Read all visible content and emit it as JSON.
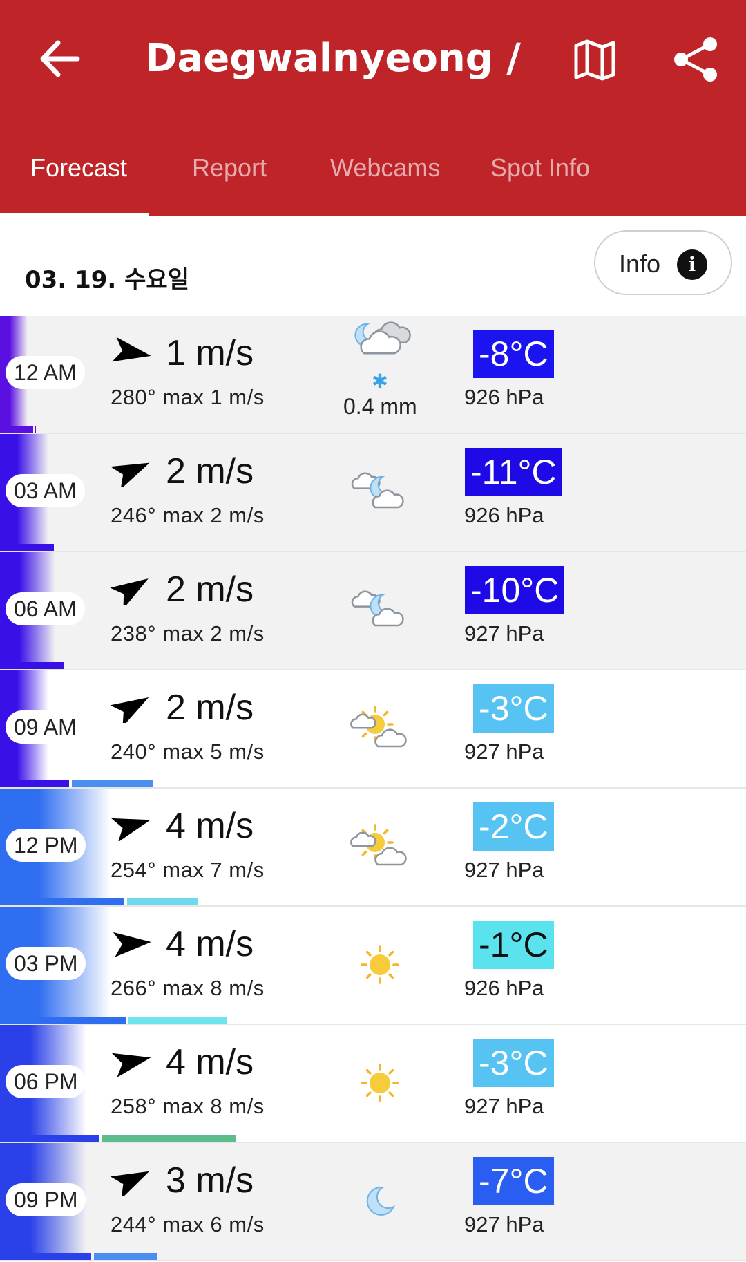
{
  "header": {
    "title": "Daegwalnyeong / P...",
    "back_icon": "arrow-left-icon",
    "map_icon": "map-icon",
    "share_icon": "share-icon",
    "background": "#bf2429"
  },
  "tabs": [
    {
      "label": "Forecast",
      "active": true
    },
    {
      "label": "Report",
      "active": false
    },
    {
      "label": "Webcams",
      "active": false
    },
    {
      "label": "Spot Info",
      "active": false
    }
  ],
  "date": "03. 19. 수요일",
  "info_button": {
    "label": "Info",
    "icon": "info-icon"
  },
  "forecast": [
    {
      "time": "12 AM",
      "speed": "1 m/s",
      "dir": "280°",
      "max": "max 1 m/s",
      "direction_deg": 280,
      "weather": "night-cloudy-snow",
      "precip": "0.4 mm",
      "temp": "-8°C",
      "temp_bg": "#1c14f0",
      "temp_fg": "#ffffff",
      "pressure": "926 hPa",
      "row_bg": "#f2f2f2",
      "grad_color": "#5a10e0"
    },
    {
      "time": "03 AM",
      "speed": "2 m/s",
      "dir": "246°",
      "max": "max 2 m/s",
      "direction_deg": 246,
      "weather": "night-partly-cloudy",
      "precip": "",
      "temp": "-11°C",
      "temp_bg": "#1e0ae6",
      "temp_fg": "#ffffff",
      "pressure": "926 hPa",
      "row_bg": "#f2f2f2",
      "grad_color": "#3a10e8"
    },
    {
      "time": "06 AM",
      "speed": "2 m/s",
      "dir": "238°",
      "max": "max 2 m/s",
      "direction_deg": 238,
      "weather": "night-partly-cloudy",
      "precip": "",
      "temp": "-10°C",
      "temp_bg": "#1e0ae6",
      "temp_fg": "#ffffff",
      "pressure": "927 hPa",
      "row_bg": "#f2f2f2",
      "grad_color": "#3a10e8"
    },
    {
      "time": "09 AM",
      "speed": "2 m/s",
      "dir": "240°",
      "max": "max 5 m/s",
      "direction_deg": 240,
      "weather": "sun-cloud",
      "precip": "",
      "temp": "-3°C",
      "temp_bg": "#56c3f2",
      "temp_fg": "#ffffff",
      "pressure": "927 hPa",
      "row_bg": "#ffffff",
      "grad_color": "#3a10e8"
    },
    {
      "time": "12 PM",
      "speed": "4 m/s",
      "dir": "254°",
      "max": "max 7 m/s",
      "direction_deg": 254,
      "weather": "sun-cloud",
      "precip": "",
      "temp": "-2°C",
      "temp_bg": "#56c3f2",
      "temp_fg": "#ffffff",
      "pressure": "927 hPa",
      "row_bg": "#ffffff",
      "grad_color": "#2f6ef0"
    },
    {
      "time": "03 PM",
      "speed": "4 m/s",
      "dir": "266°",
      "max": "max 8 m/s",
      "direction_deg": 266,
      "weather": "sun",
      "precip": "",
      "temp": "-1°C",
      "temp_bg": "#5ae3ee",
      "temp_fg": "#111111",
      "pressure": "926 hPa",
      "row_bg": "#ffffff",
      "grad_color": "#2f6ef0"
    },
    {
      "time": "06 PM",
      "speed": "4 m/s",
      "dir": "258°",
      "max": "max 8 m/s",
      "direction_deg": 258,
      "weather": "sun",
      "precip": "",
      "temp": "-3°C",
      "temp_bg": "#56c3f2",
      "temp_fg": "#ffffff",
      "pressure": "927 hPa",
      "row_bg": "#ffffff",
      "grad_color": "#2a40e8"
    },
    {
      "time": "09 PM",
      "speed": "3 m/s",
      "dir": "244°",
      "max": "max 6 m/s",
      "direction_deg": 244,
      "weather": "moon",
      "precip": "",
      "temp": "-7°C",
      "temp_bg": "#2a5ef2",
      "temp_fg": "#ffffff",
      "pressure": "927 hPa",
      "row_bg": "#f2f2f2",
      "grad_color": "#2a40e8"
    }
  ],
  "wind_bars": [
    {
      "avg_color": "#5a10e0",
      "gust_color": "#5a10e0"
    },
    {
      "avg_color": "#3a10e8",
      "gust_color": "#3a10e8"
    },
    {
      "avg_color": "#3a10e8",
      "gust_color": "#3a10e8"
    },
    {
      "avg_color": "#3a10e8",
      "gust_color": "#4a8ff0"
    },
    {
      "avg_color": "#2f6ef0",
      "gust_color": "#6ed8ef"
    },
    {
      "avg_color": "#2f6ef0",
      "gust_color": "#6ee4ee"
    },
    {
      "avg_color": "#2a40e8",
      "gust_color": "#5dbb8c"
    },
    {
      "avg_color": "#2a40e8",
      "gust_color": "#4a8ff0"
    }
  ]
}
